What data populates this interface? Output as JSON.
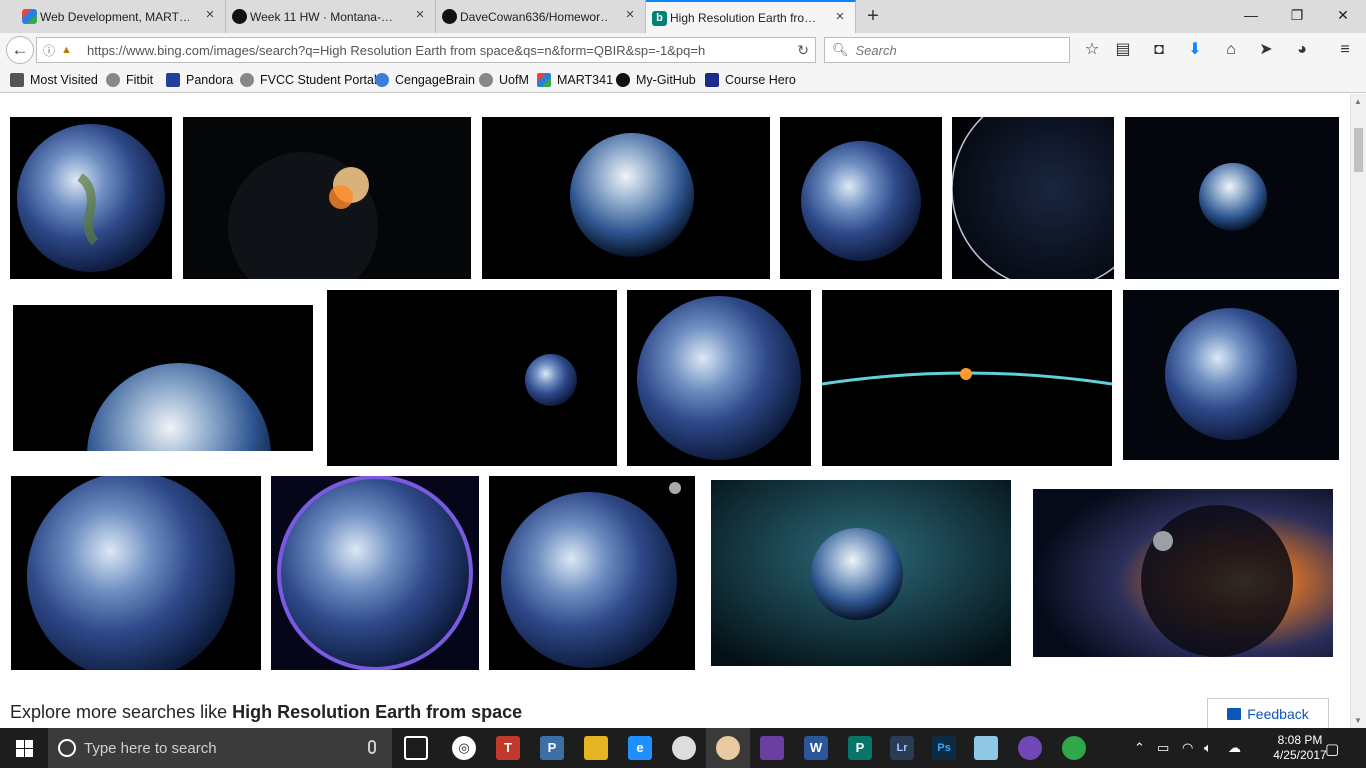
{
  "browser": {
    "tabs": [
      {
        "title": "Web Development, MART…",
        "favicon_color": "#e8453c"
      },
      {
        "title": "Week 11 HW · Montana-…",
        "favicon_color": "#111111"
      },
      {
        "title": "DaveCowan636/Homewor…",
        "favicon_color": "#111111"
      },
      {
        "title": "High Resolution Earth fro…",
        "favicon_color": "#008373"
      }
    ],
    "new_tab_label": "+",
    "window_controls": {
      "minimize": "—",
      "restore": "❐",
      "close": "✕"
    },
    "url": "https://www.bing.com/images/search?q=High Resolution Earth from space&qs=n&form=QBIR&sp=-1&pq=h",
    "search_placeholder": "Search",
    "bookmarks": [
      {
        "label": "Most Visited",
        "color": "#555555"
      },
      {
        "label": "Fitbit",
        "color": "#888888"
      },
      {
        "label": "Pandora",
        "color": "#224099"
      },
      {
        "label": "FVCC Student Portal",
        "color": "#888888"
      },
      {
        "label": "CengageBrain",
        "color": "#3b7dd8"
      },
      {
        "label": "UofM",
        "color": "#888888"
      },
      {
        "label": "MART341",
        "color": "#e8453c"
      },
      {
        "label": "My-GitHub",
        "color": "#111111"
      },
      {
        "label": "Course Hero",
        "color": "#1a2b8c"
      }
    ]
  },
  "page": {
    "explore_prefix": "Explore more searches like ",
    "explore_query": "High Resolution Earth from space",
    "feedback_label": "Feedback"
  },
  "taskbar": {
    "search_placeholder": "Type here to search",
    "clock_time": "8:08 PM",
    "clock_date": "4/25/2017",
    "apps": [
      {
        "label": "T",
        "color": "#c0392b"
      },
      {
        "label": "P",
        "color": "#3d6fa7"
      },
      {
        "label": "",
        "color": "#e6b422"
      },
      {
        "label": "e",
        "color": "#1e90ff"
      },
      {
        "label": "",
        "color": "#dddddd"
      },
      {
        "label": "",
        "color": "#e8c9a0"
      },
      {
        "label": "",
        "color": "#6a3ea1"
      },
      {
        "label": "W",
        "color": "#2b579a"
      },
      {
        "label": "P",
        "color": "#077568"
      },
      {
        "label": "Lr",
        "color": "#2b3a55"
      },
      {
        "label": "Ps",
        "color": "#0f2a45"
      },
      {
        "label": "",
        "color": "#8fc8e6"
      },
      {
        "label": "",
        "color": "#7248b9"
      },
      {
        "label": "",
        "color": "#2ea84a"
      }
    ]
  }
}
